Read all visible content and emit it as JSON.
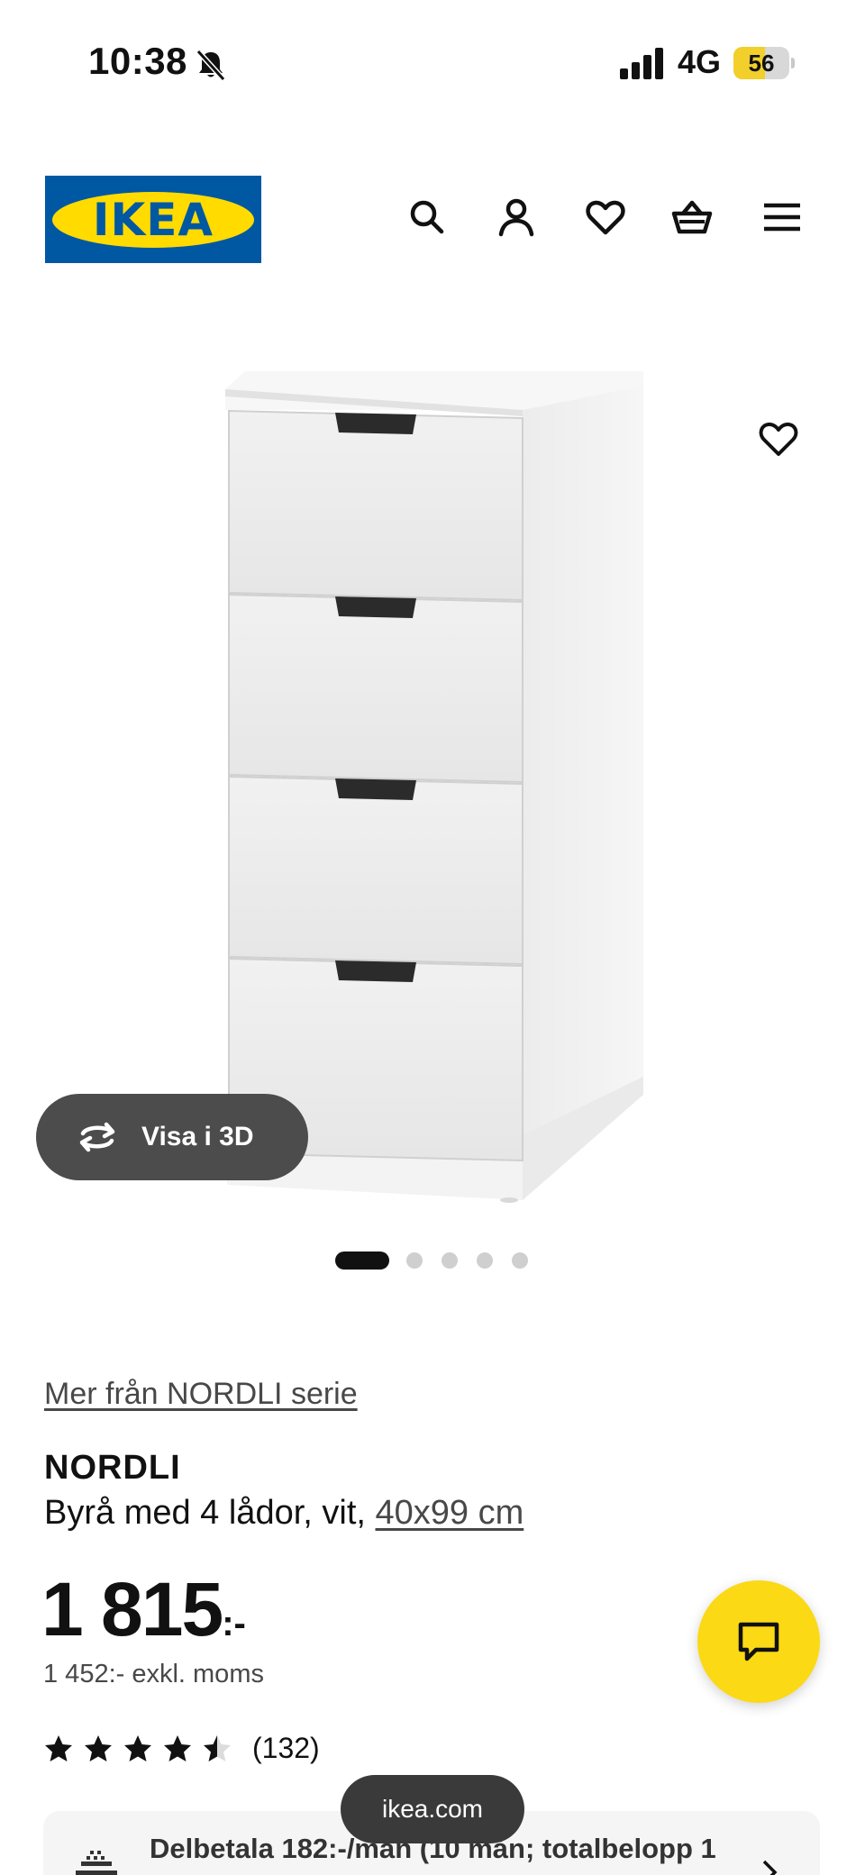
{
  "status_bar": {
    "time": "10:38",
    "network": "4G",
    "battery": "56",
    "battery_level": 0.56,
    "battery_color": "#f2cf2a",
    "icons": [
      "bell-slash-icon",
      "signal-icon",
      "battery-icon"
    ]
  },
  "header": {
    "logo_text": "IKEA",
    "logo_colors": {
      "blue": "#0058a3",
      "yellow": "#ffdb00"
    },
    "icons": [
      "search-icon",
      "account-icon",
      "heart-icon",
      "basket-icon",
      "menu-icon"
    ]
  },
  "product_image": {
    "favorite_icon": "heart-icon",
    "view_3d_label": "Visa i 3D",
    "view_3d_icon": "rotate-icon"
  },
  "carousel": {
    "total": 5,
    "active": 1
  },
  "product": {
    "series_link": "Mer från NORDLI serie",
    "name": "NORDLI",
    "description": "Byrå med 4 lådor, vit, ",
    "size": "40x99 cm",
    "price": "1 815",
    "price_suffix": ":-",
    "price_ex_vat": "1 452:- exkl. moms",
    "rating_value": 4.5,
    "rating_max": 5,
    "review_count": "(132)"
  },
  "installment": {
    "text": "Delbetala 182:-/mån (10 mån; totalbelopp 1",
    "icon": "payment-icon"
  },
  "chat": {
    "icon": "chat-icon",
    "color": "#fbd914"
  },
  "browser": {
    "domain": "ikea.com"
  }
}
